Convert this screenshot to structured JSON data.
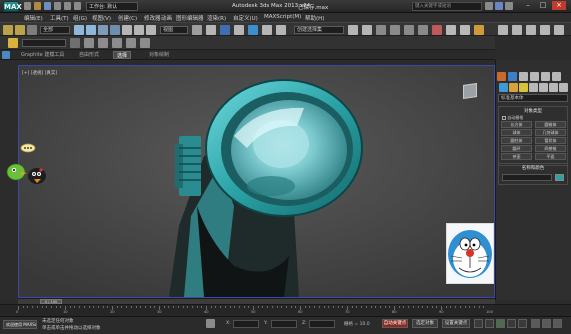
{
  "titlebar": {
    "logo": "MAX",
    "workspace": "工作台: 默认",
    "app_title": "Autodesk 3ds Max  2013 x64",
    "doc_title": "已保存.max",
    "search_placeholder": "键入关键字或短语"
  },
  "menu": [
    {
      "label": "编辑(E)"
    },
    {
      "label": "工具(T)"
    },
    {
      "label": "组(G)"
    },
    {
      "label": "视图(V)"
    },
    {
      "label": "创建(C)"
    },
    {
      "label": "修改器"
    },
    {
      "label": "动画"
    },
    {
      "label": "图形编辑器"
    },
    {
      "label": "渲染(R)"
    },
    {
      "label": "自定义(U)"
    },
    {
      "label": "MAXScript(M)"
    },
    {
      "label": "帮助(H)"
    }
  ],
  "toolbar": {
    "filter_select": "全部",
    "view_select": "视图",
    "named_sel_placeholder": "创建选择集"
  },
  "ribbon": {
    "tabs": [
      {
        "label": "Graphite 建模工具",
        "active": false
      },
      {
        "label": "自由形式",
        "active": false
      },
      {
        "label": "选择",
        "active": true
      },
      {
        "label": "对象绘制",
        "active": false
      }
    ]
  },
  "viewport": {
    "label": "[+] [透视] [真实]"
  },
  "command_panel": {
    "category_select": "标准基本体",
    "rollout_title": "对象类型",
    "autogrid_label": "自动栅格",
    "buttons": [
      "长方体",
      "圆锥体",
      "球体",
      "几何球体",
      "圆柱体",
      "管状体",
      "圆环",
      "四棱锥",
      "茶壶",
      "平面"
    ],
    "name_rollout_title": "名称和颜色",
    "object_color": "#2aa3a6"
  },
  "timeline": {
    "slider": "0 / 100",
    "ticks": [
      "0",
      "10",
      "20",
      "30",
      "40",
      "50",
      "60",
      "70",
      "80",
      "90",
      "100"
    ]
  },
  "status": {
    "welcome": "欢迎使用 MAXSc",
    "line1": "未选定任何对象",
    "line2": "单击或单击并拖动以选择对象",
    "x_label": "X:",
    "y_label": "Y:",
    "z_label": "Z:",
    "grid_label": "栅格 = 10.0",
    "auto_key": "自动关键点",
    "selected_object": "选定对象",
    "set_key": "设置关键点",
    "key_filters": "关键点过滤器..."
  }
}
